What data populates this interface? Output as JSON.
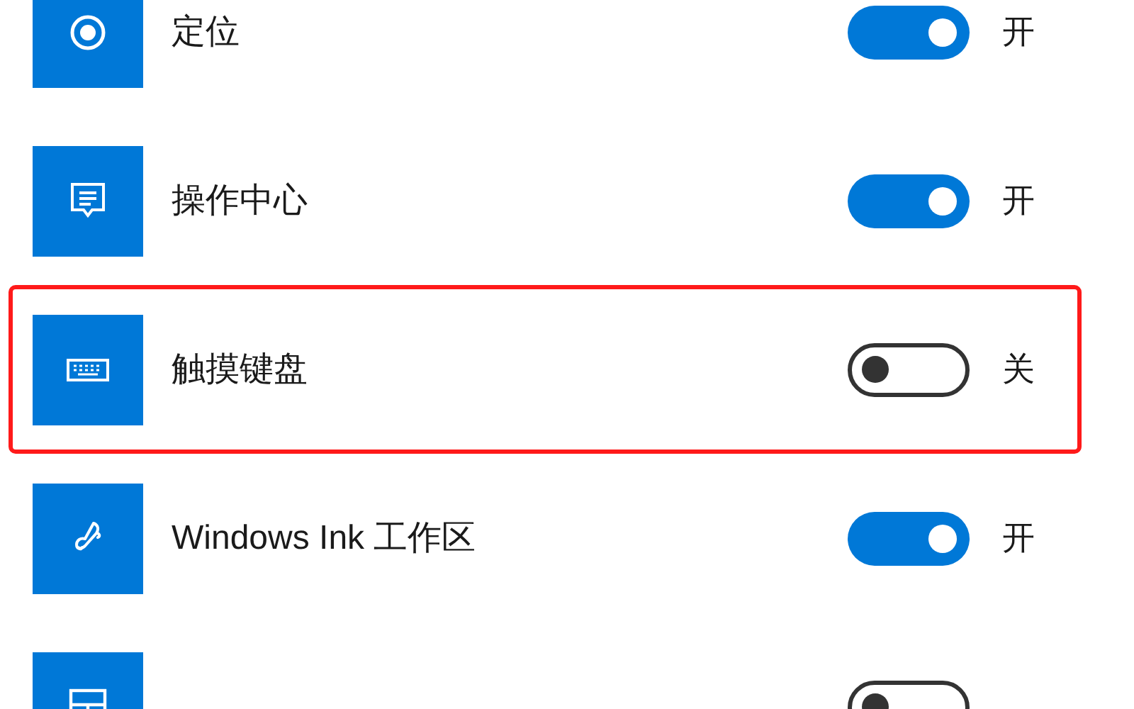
{
  "settings": [
    {
      "kind": "location",
      "label": "定位",
      "on": true,
      "state_text": "开",
      "highlighted": false
    },
    {
      "kind": "message",
      "label": "操作中心",
      "on": true,
      "state_text": "开",
      "highlighted": false
    },
    {
      "kind": "keyboard",
      "label": "触摸键盘",
      "on": false,
      "state_text": "关",
      "highlighted": true
    },
    {
      "kind": "pen",
      "label": "Windows Ink 工作区",
      "on": true,
      "state_text": "开",
      "highlighted": false
    },
    {
      "kind": "touchpad",
      "on": false,
      "highlighted": false
    }
  ]
}
